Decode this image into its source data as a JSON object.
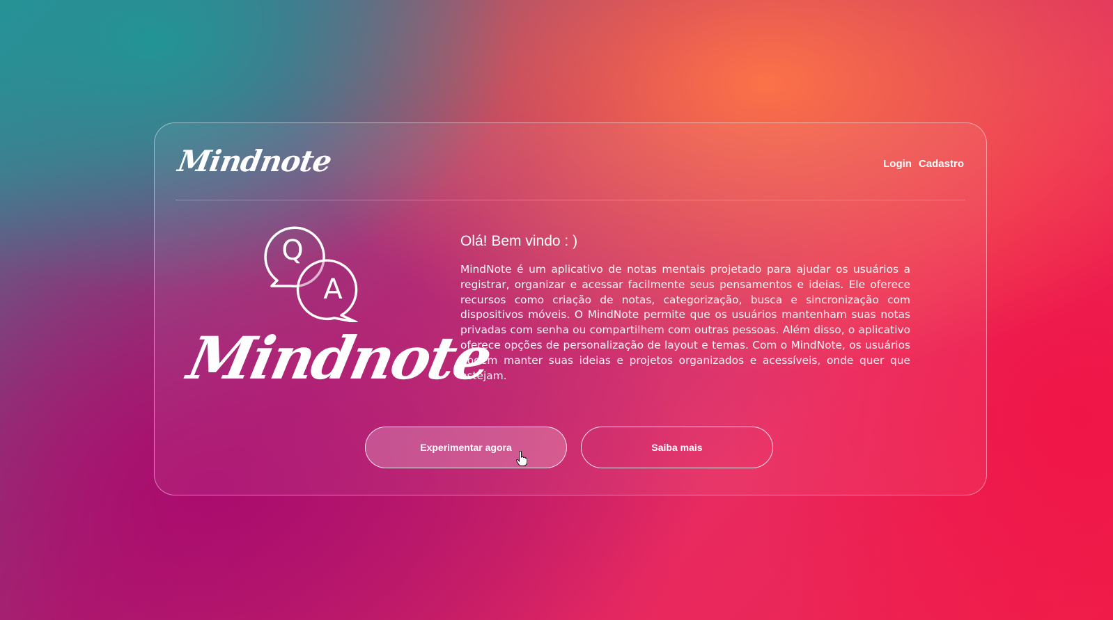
{
  "header": {
    "logo_text": "Mindnote",
    "nav": {
      "login_label": "Login",
      "register_label": "Cadastro"
    }
  },
  "hero": {
    "illustration_icon": "qa-chat-bubbles-icon",
    "illustration_letters": {
      "q": "Q",
      "a": "A"
    },
    "brand_text": "Mindnote",
    "welcome_title": "Olá! Bem vindo : )",
    "description": "MindNote é um aplicativo de notas mentais projetado para ajudar os usuários a registrar, organizar e acessar facilmente seus pensamentos e ideias. Ele oferece recursos como criação de notas, categorização, busca e sincronização com dispositivos móveis. O MindNote permite que os usuários mantenham suas notas privadas com senha ou compartilhem com outras pessoas. Além disso, o aplicativo oferece opções de personalização de layout e temas. Com o MindNote, os usuários podem manter suas ideias e projetos organizados e acessíveis, onde quer que estejam."
  },
  "actions": {
    "primary_label": "Experimentar agora",
    "secondary_label": "Saiba mais"
  },
  "colors": {
    "teal": "#2a8f98",
    "orange": "#ff7646",
    "magenta": "#b0246e",
    "red": "#f0204a"
  }
}
